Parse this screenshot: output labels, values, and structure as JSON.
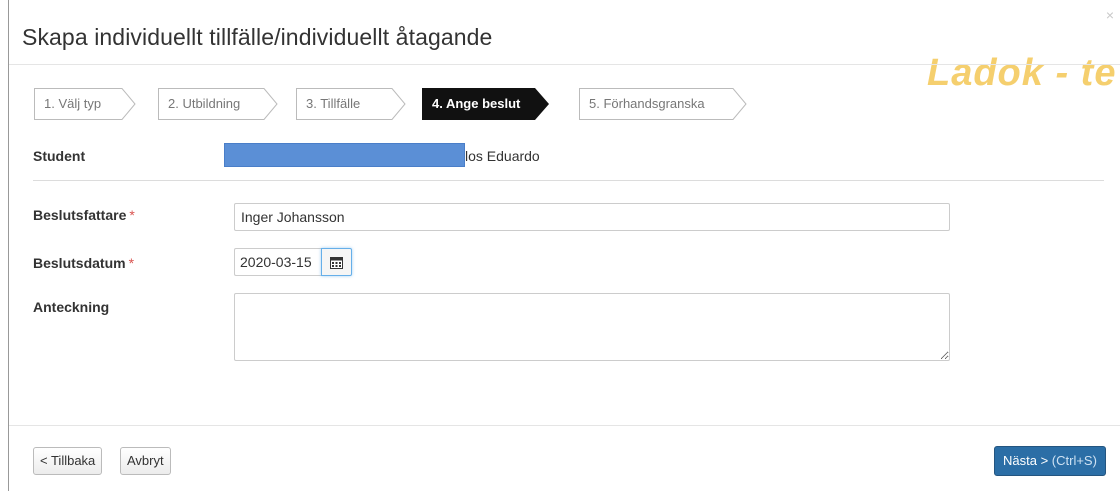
{
  "modal": {
    "title": "Skapa individuellt tillfälle/individuellt åtagande",
    "close_label": "×",
    "watermark": "Ladok - te"
  },
  "steps": [
    {
      "label": "1. Välj typ",
      "active": false
    },
    {
      "label": "2. Utbildning",
      "active": false
    },
    {
      "label": "3. Tillfälle",
      "active": false
    },
    {
      "label": "4. Ange beslut",
      "active": true
    },
    {
      "label": "5. Förhandsgranska",
      "active": false
    }
  ],
  "student": {
    "label": "Student",
    "name_visible": "los Eduardo"
  },
  "form": {
    "beslutsfattare_label": "Beslutsfattare",
    "beslutsfattare_value": "Inger Johansson",
    "beslutsdatum_label": "Beslutsdatum",
    "beslutsdatum_value": "2020-03-15",
    "anteckning_label": "Anteckning",
    "anteckning_value": "",
    "required_mark": "*"
  },
  "footer": {
    "back_label": "< Tillbaka",
    "cancel_label": "Avbryt",
    "next_label": "Nästa >",
    "next_shortcut": "(Ctrl+S)"
  },
  "colors": {
    "active_step": "#111111",
    "primary_button": "#2b6ea6",
    "redaction": "#5b8fd6",
    "required": "#d9534f",
    "watermark": "#f5cf6e"
  },
  "icons": {
    "close": "close-icon",
    "calendar": "calendar-icon"
  }
}
